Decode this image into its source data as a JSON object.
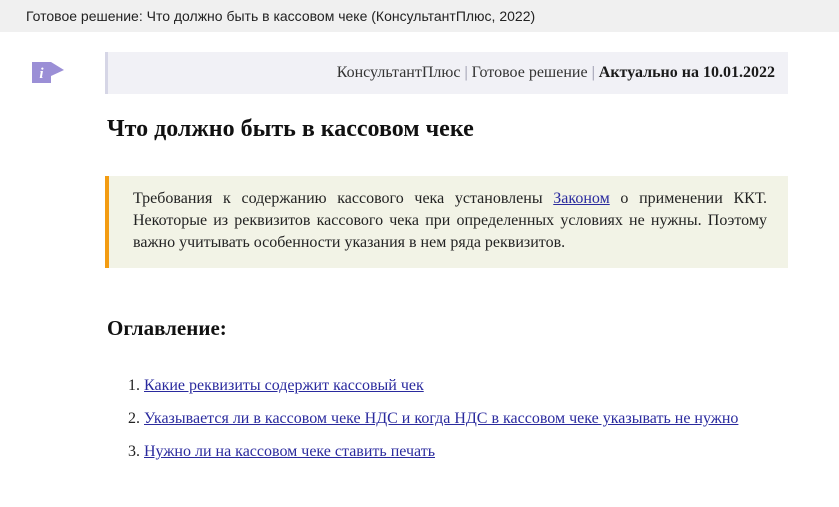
{
  "window": {
    "title": "Готовое решение: Что должно быть в кассовом чеке (КонсультантПлюс, 2022)"
  },
  "meta": {
    "source": "КонсультантПлюс",
    "separator": "|",
    "type": "Готовое решение",
    "actual_label": "Актуально на 10.01.2022"
  },
  "icons": {
    "info": "info-icon",
    "info_color": "#9b8fd6"
  },
  "title": "Что должно быть в кассовом чеке",
  "note": {
    "text_before": "Требования к содержанию кассового чека установлены ",
    "link": "Законом",
    "text_after": " о применении ККТ. Некоторые из реквизитов кассового чека при определенных условиях не нужны. Поэтому важно учитывать особенности указания в нем ряда реквизитов.",
    "accent_color": "#f39c12"
  },
  "toc": {
    "heading": "Оглавление:",
    "items": [
      {
        "label": "Какие реквизиты содержит кассовый чек"
      },
      {
        "label": "Указывается ли в кассовом чеке НДС и когда НДС в кассовом чеке указывать не нужно"
      },
      {
        "label": "Нужно ли на кассовом чеке ставить печать"
      }
    ]
  }
}
